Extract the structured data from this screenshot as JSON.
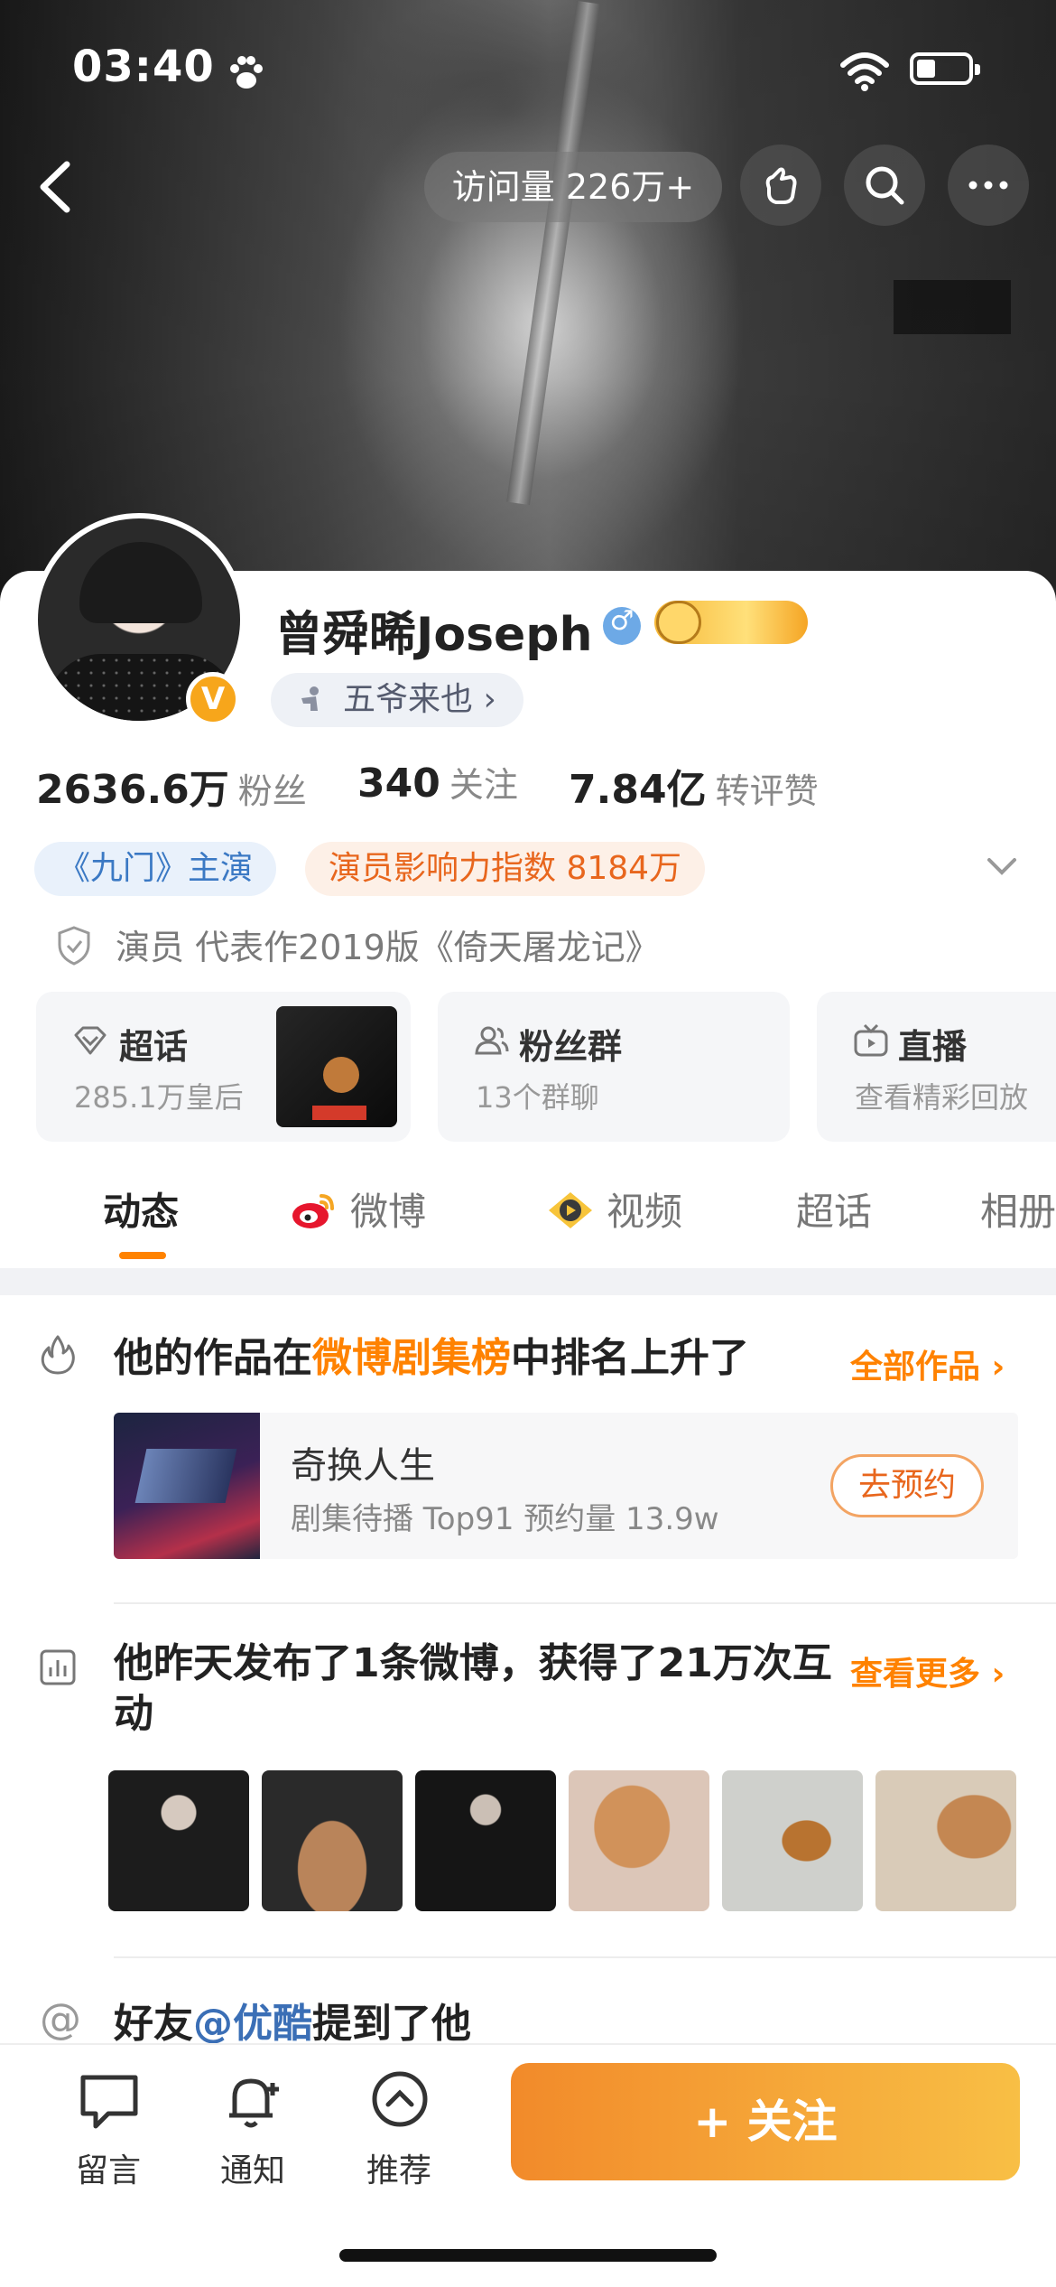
{
  "status_bar": {
    "time": "03:40"
  },
  "header": {
    "visit_count": "访问量 226万+"
  },
  "profile": {
    "name": "曾舜晞Joseph",
    "verified_badge": "V",
    "tag": "五爷来也 ›",
    "stats": [
      {
        "value": "2636.6万",
        "label": "粉丝"
      },
      {
        "value": "340",
        "label": "关注"
      },
      {
        "value": "7.84亿",
        "label": "转评赞"
      }
    ],
    "chips": [
      "《九门》主演",
      "演员影响力指数 8184万"
    ],
    "description": "演员 代表作2019版《倚天屠龙记》"
  },
  "feature_cards": [
    {
      "title": "超话",
      "subtitle": "285.1万皇后"
    },
    {
      "title": "粉丝群",
      "subtitle": "13个群聊"
    },
    {
      "title": "直播",
      "subtitle": "查看精彩回放"
    }
  ],
  "tabs": [
    "动态",
    "微博",
    "视频",
    "超话",
    "相册"
  ],
  "sections": {
    "ranking": {
      "title_pre": "他的作品在",
      "title_hl": "微博剧集榜",
      "title_post": "中排名上升了",
      "link": "全部作品 ›",
      "show": {
        "title": "奇换人生",
        "meta": "剧集待播 Top91 预约量 13.9w",
        "button": "去预约"
      }
    },
    "activity": {
      "title": "他昨天发布了1条微博，获得了21万次互动",
      "link": "查看更多 ›"
    },
    "mention": {
      "prefix": "好友",
      "link": "@优酷",
      "suffix": "提到了他"
    }
  },
  "bottom_bar": {
    "items": [
      "留言",
      "通知",
      "推荐"
    ],
    "follow": "+ 关注"
  },
  "colors": {
    "accent": "#ff8200",
    "link_blue": "#3b6fb6",
    "follow_gradient_start": "#f28a2a",
    "follow_gradient_end": "#f8bf45"
  }
}
